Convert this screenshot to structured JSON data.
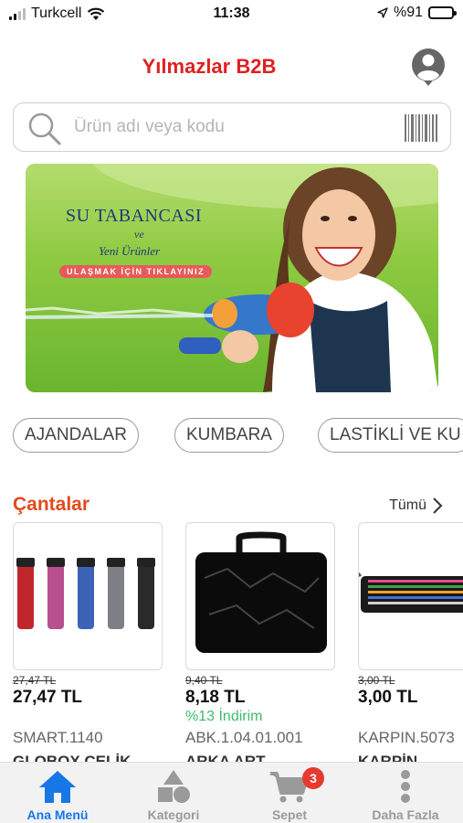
{
  "status_bar": {
    "carrier": "Turkcell",
    "time": "11:38",
    "battery": "%91",
    "battery_level": 0.91
  },
  "header": {
    "title": "Yılmazlar B2B",
    "profile_icon": "user-circle-icon"
  },
  "search": {
    "placeholder": "Ürün adı veya kodu",
    "value": "",
    "search_icon": "search-icon",
    "barcode_icon": "barcode-icon"
  },
  "banner": {
    "title": "SU TABANCASI",
    "connector": "ve",
    "subtitle": "Yeni Ürünler",
    "cta": "ULAŞMAK İÇİN TIKLAYINIZ"
  },
  "categories": [
    {
      "label": "AJANDALAR"
    },
    {
      "label": "KUMBARA"
    },
    {
      "label": "LASTİKLİ VE KU"
    }
  ],
  "section": {
    "title": "Çantalar",
    "see_all": "Tümü"
  },
  "products": [
    {
      "old_price": "27,47 TL",
      "price": "27,47 TL",
      "discount": "",
      "code": "SMART.1140",
      "name": "GLOBOX ÇELİK"
    },
    {
      "old_price": "9,40 TL",
      "price": "8,18 TL",
      "discount": "%13 İndirim",
      "code": "ABK.1.04.01.001",
      "name": "ARKA ART"
    },
    {
      "old_price": "3,00 TL",
      "price": "3,00 TL",
      "discount": "",
      "code": "KARPIN.5073",
      "name": "KARPİN"
    }
  ],
  "tabbar": {
    "items": [
      {
        "label": "Ana Menü",
        "icon": "home-icon",
        "active": true
      },
      {
        "label": "Kategori",
        "icon": "shapes-icon",
        "active": false
      },
      {
        "label": "Sepet",
        "icon": "cart-icon",
        "active": false,
        "badge": "3"
      },
      {
        "label": "Daha Fazla",
        "icon": "more-icon",
        "active": false
      }
    ]
  },
  "colors": {
    "brand": "#e02020",
    "section_title": "#e24a1c",
    "active_tab": "#1677e5",
    "discount": "#3fba6c",
    "badge": "#e8392f"
  }
}
